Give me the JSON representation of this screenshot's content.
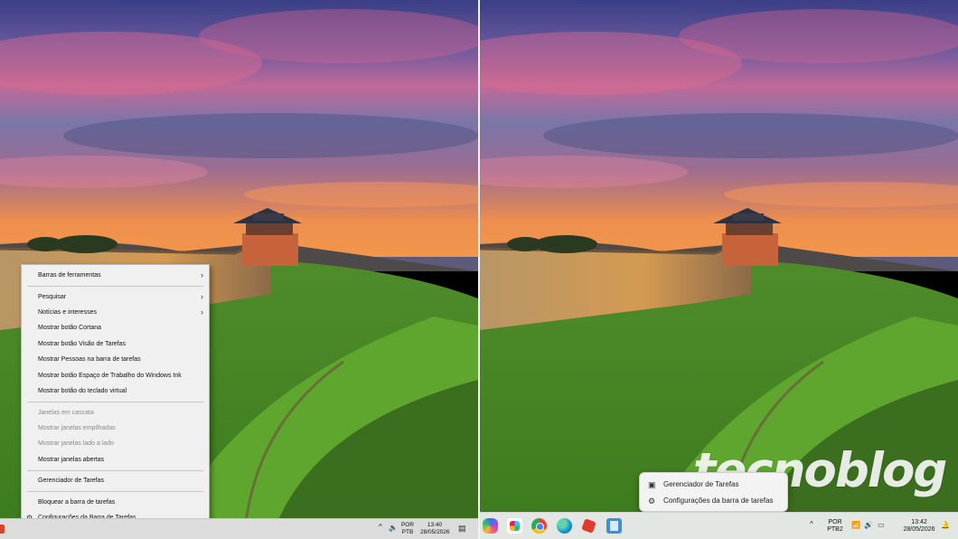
{
  "left": {
    "context_menu": {
      "items": [
        {
          "label": "Barras de ferramentas",
          "submenu": true
        },
        {
          "separator": true
        },
        {
          "label": "Pesquisar",
          "submenu": true
        },
        {
          "label": "Notícias e interesses",
          "submenu": true
        },
        {
          "label": "Mostrar botão Cortana"
        },
        {
          "label": "Mostrar botão Visão de Tarefas"
        },
        {
          "label": "Mostrar Pessoas na barra de tarefas"
        },
        {
          "label": "Mostrar botão Espaço de Trabalho do Windows Ink"
        },
        {
          "label": "Mostrar botão do teclado virtual"
        },
        {
          "separator": true
        },
        {
          "label": "Janelas em cascata",
          "disabled": true
        },
        {
          "label": "Mostrar janelas empilhadas",
          "disabled": true
        },
        {
          "label": "Mostrar janelas lado a lado",
          "disabled": true
        },
        {
          "label": "Mostrar janelas abertas"
        },
        {
          "separator": true
        },
        {
          "label": "Gerenciador de Tarefas"
        },
        {
          "separator": true
        },
        {
          "label": "Bloquear a barra de tarefas"
        },
        {
          "label": "Configurações da Barra de Tarefas",
          "icon": "gear-icon"
        }
      ]
    },
    "taskbar": {
      "lang_top": "POR",
      "lang_bottom": "PTB",
      "time": "13:40",
      "date": "28/05/2026"
    }
  },
  "right": {
    "context_menu": {
      "task_manager": "Gerenciador de Tarefas",
      "taskbar_settings": "Configurações da barra de tarefas"
    },
    "taskbar": {
      "apps": [
        "copilot-icon",
        "slack-icon",
        "chrome-icon",
        "edge-icon",
        "puzzle-app-icon",
        "notepad-icon"
      ],
      "lang_top": "POR",
      "lang_bottom": "PTB2",
      "time": "13:42",
      "date": "28/05/2026"
    }
  },
  "watermark": "tecnoblog",
  "colors": {
    "menu_bg": "#f0f0f0",
    "disabled_text": "#8a8a8a",
    "taskbar_win10": "#dcdcdc",
    "taskbar_win11": "#e3e7e3"
  }
}
